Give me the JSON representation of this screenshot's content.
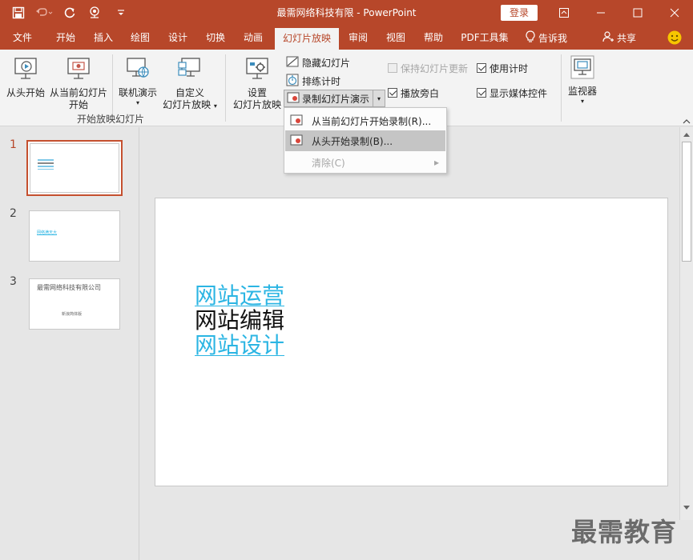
{
  "window": {
    "title": "最需网络科技有限  -  PowerPoint",
    "login_label": "登录"
  },
  "tabs": [
    "文件",
    "开始",
    "插入",
    "绘图",
    "设计",
    "切换",
    "动画",
    "幻灯片放映",
    "审阅",
    "视图",
    "帮助",
    "PDF工具集"
  ],
  "active_tab": "幻灯片放映",
  "tell_me": "告诉我",
  "share": "共享",
  "ribbon": {
    "from_beginning": "从头开始",
    "from_current_l1": "从当前幻灯片",
    "from_current_l2": "开始",
    "online_present": "联机演示",
    "custom_l1": "自定义",
    "custom_l2": "幻灯片放映",
    "group_start": "开始放映幻灯片",
    "setup_l1": "设置",
    "setup_l2": "幻灯片放映",
    "hide_slide": "隐藏幻灯片",
    "rehearse": "排练计时",
    "record": "录制幻灯片演示",
    "keep_updated": "保持幻灯片更新",
    "use_timings": "使用计时",
    "play_narrations": "播放旁白",
    "show_media": "显示媒体控件",
    "monitor": "监视器"
  },
  "checks": {
    "keep_updated": false,
    "use_timings": true,
    "play_narrations": true,
    "show_media": true
  },
  "dropdown": {
    "item1": "从当前幻灯片开始录制(R)...",
    "item2": "从头开始录制(B)...",
    "item3": "清除(C)"
  },
  "slides": [
    {
      "num": "1",
      "lines": []
    },
    {
      "num": "2",
      "text": "网络满天大"
    },
    {
      "num": "3",
      "title": "最需网络科技有限公司",
      "subtitle": "新浪简体版"
    }
  ],
  "slide_main": {
    "line1": "网站运营",
    "line2": "网站编辑",
    "line3": "网站设计"
  },
  "watermark": "最需教育"
}
